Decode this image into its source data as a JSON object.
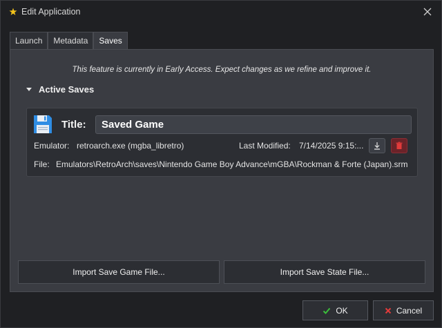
{
  "window": {
    "title": "Edit Application",
    "close_icon": "close-icon",
    "app_icon": "app-star-icon"
  },
  "tabs": [
    {
      "label": "Launch",
      "active": false
    },
    {
      "label": "Metadata",
      "active": false
    },
    {
      "label": "Saves",
      "active": true
    }
  ],
  "saves": {
    "notice": "This feature is currently in Early Access. Expect changes as we refine and improve it.",
    "section_label": "Active Saves",
    "card": {
      "title_label": "Title:",
      "title_value": "Saved Game",
      "emulator_label": "Emulator:",
      "emulator_value": "retroarch.exe (mgba_libretro)",
      "modified_label": "Last Modified:",
      "modified_value": "7/14/2025 9:15:...",
      "file_label": "File:",
      "file_value": "Emulators\\RetroArch\\saves\\Nintendo Game Boy Advance\\mGBA\\Rockman & Forte (Japan).srm",
      "save_icon": "floppy-disk-icon",
      "download_icon": "download-icon",
      "delete_icon": "trash-icon"
    },
    "import_game_label": "Import Save Game File...",
    "import_state_label": "Import Save State File..."
  },
  "footer": {
    "ok_label": "OK",
    "cancel_label": "Cancel"
  },
  "colors": {
    "background": "#1f2023",
    "panel": "#3a3c42",
    "card": "#2c2e33",
    "accent_ok": "#3bbf3b",
    "accent_cancel": "#e23b3b",
    "delete_button": "#6b2329"
  }
}
